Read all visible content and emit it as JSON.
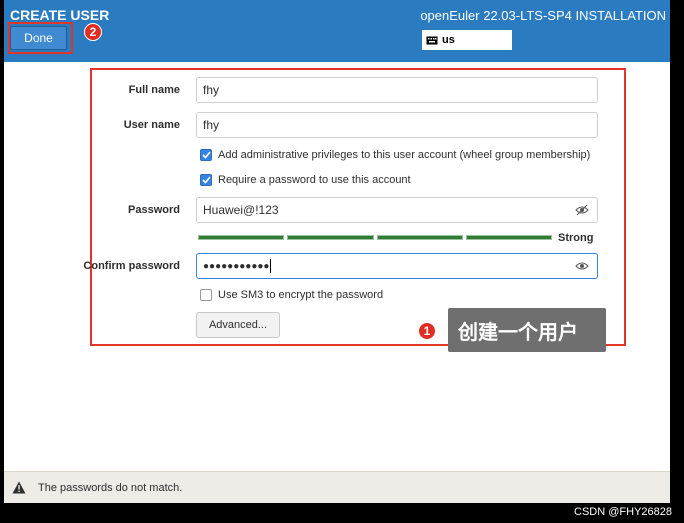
{
  "header": {
    "title": "CREATE USER",
    "done_label": "Done",
    "product": "openEuler 22.03-LTS-SP4 INSTALLATION",
    "keyboard_layout": "us",
    "accent_color": "#2a7bc0"
  },
  "form": {
    "full_name_label": "Full name",
    "full_name_value": "fhy",
    "user_name_label": "User name",
    "user_name_value": "fhy",
    "admin_checkbox_label": "Add administrative privileges to this user account (wheel group membership)",
    "admin_checked": true,
    "require_password_label": "Require a password to use this account",
    "require_password_checked": true,
    "password_label": "Password",
    "password_value": "Huawei@!123",
    "strength_label": "Strong",
    "confirm_label": "Confirm password",
    "confirm_value": "●●●●●●●●●●●",
    "sm3_label": "Use SM3 to encrypt the password",
    "sm3_checked": false,
    "advanced_label": "Advanced..."
  },
  "annotations": {
    "step1_number": "1",
    "step1_text": "创建一个用户",
    "step2_number": "2",
    "highlight_color": "#e0362a"
  },
  "status": {
    "warning_icon": "warning-icon",
    "message": "The passwords do not match."
  },
  "watermark": "CSDN @FHY26828"
}
